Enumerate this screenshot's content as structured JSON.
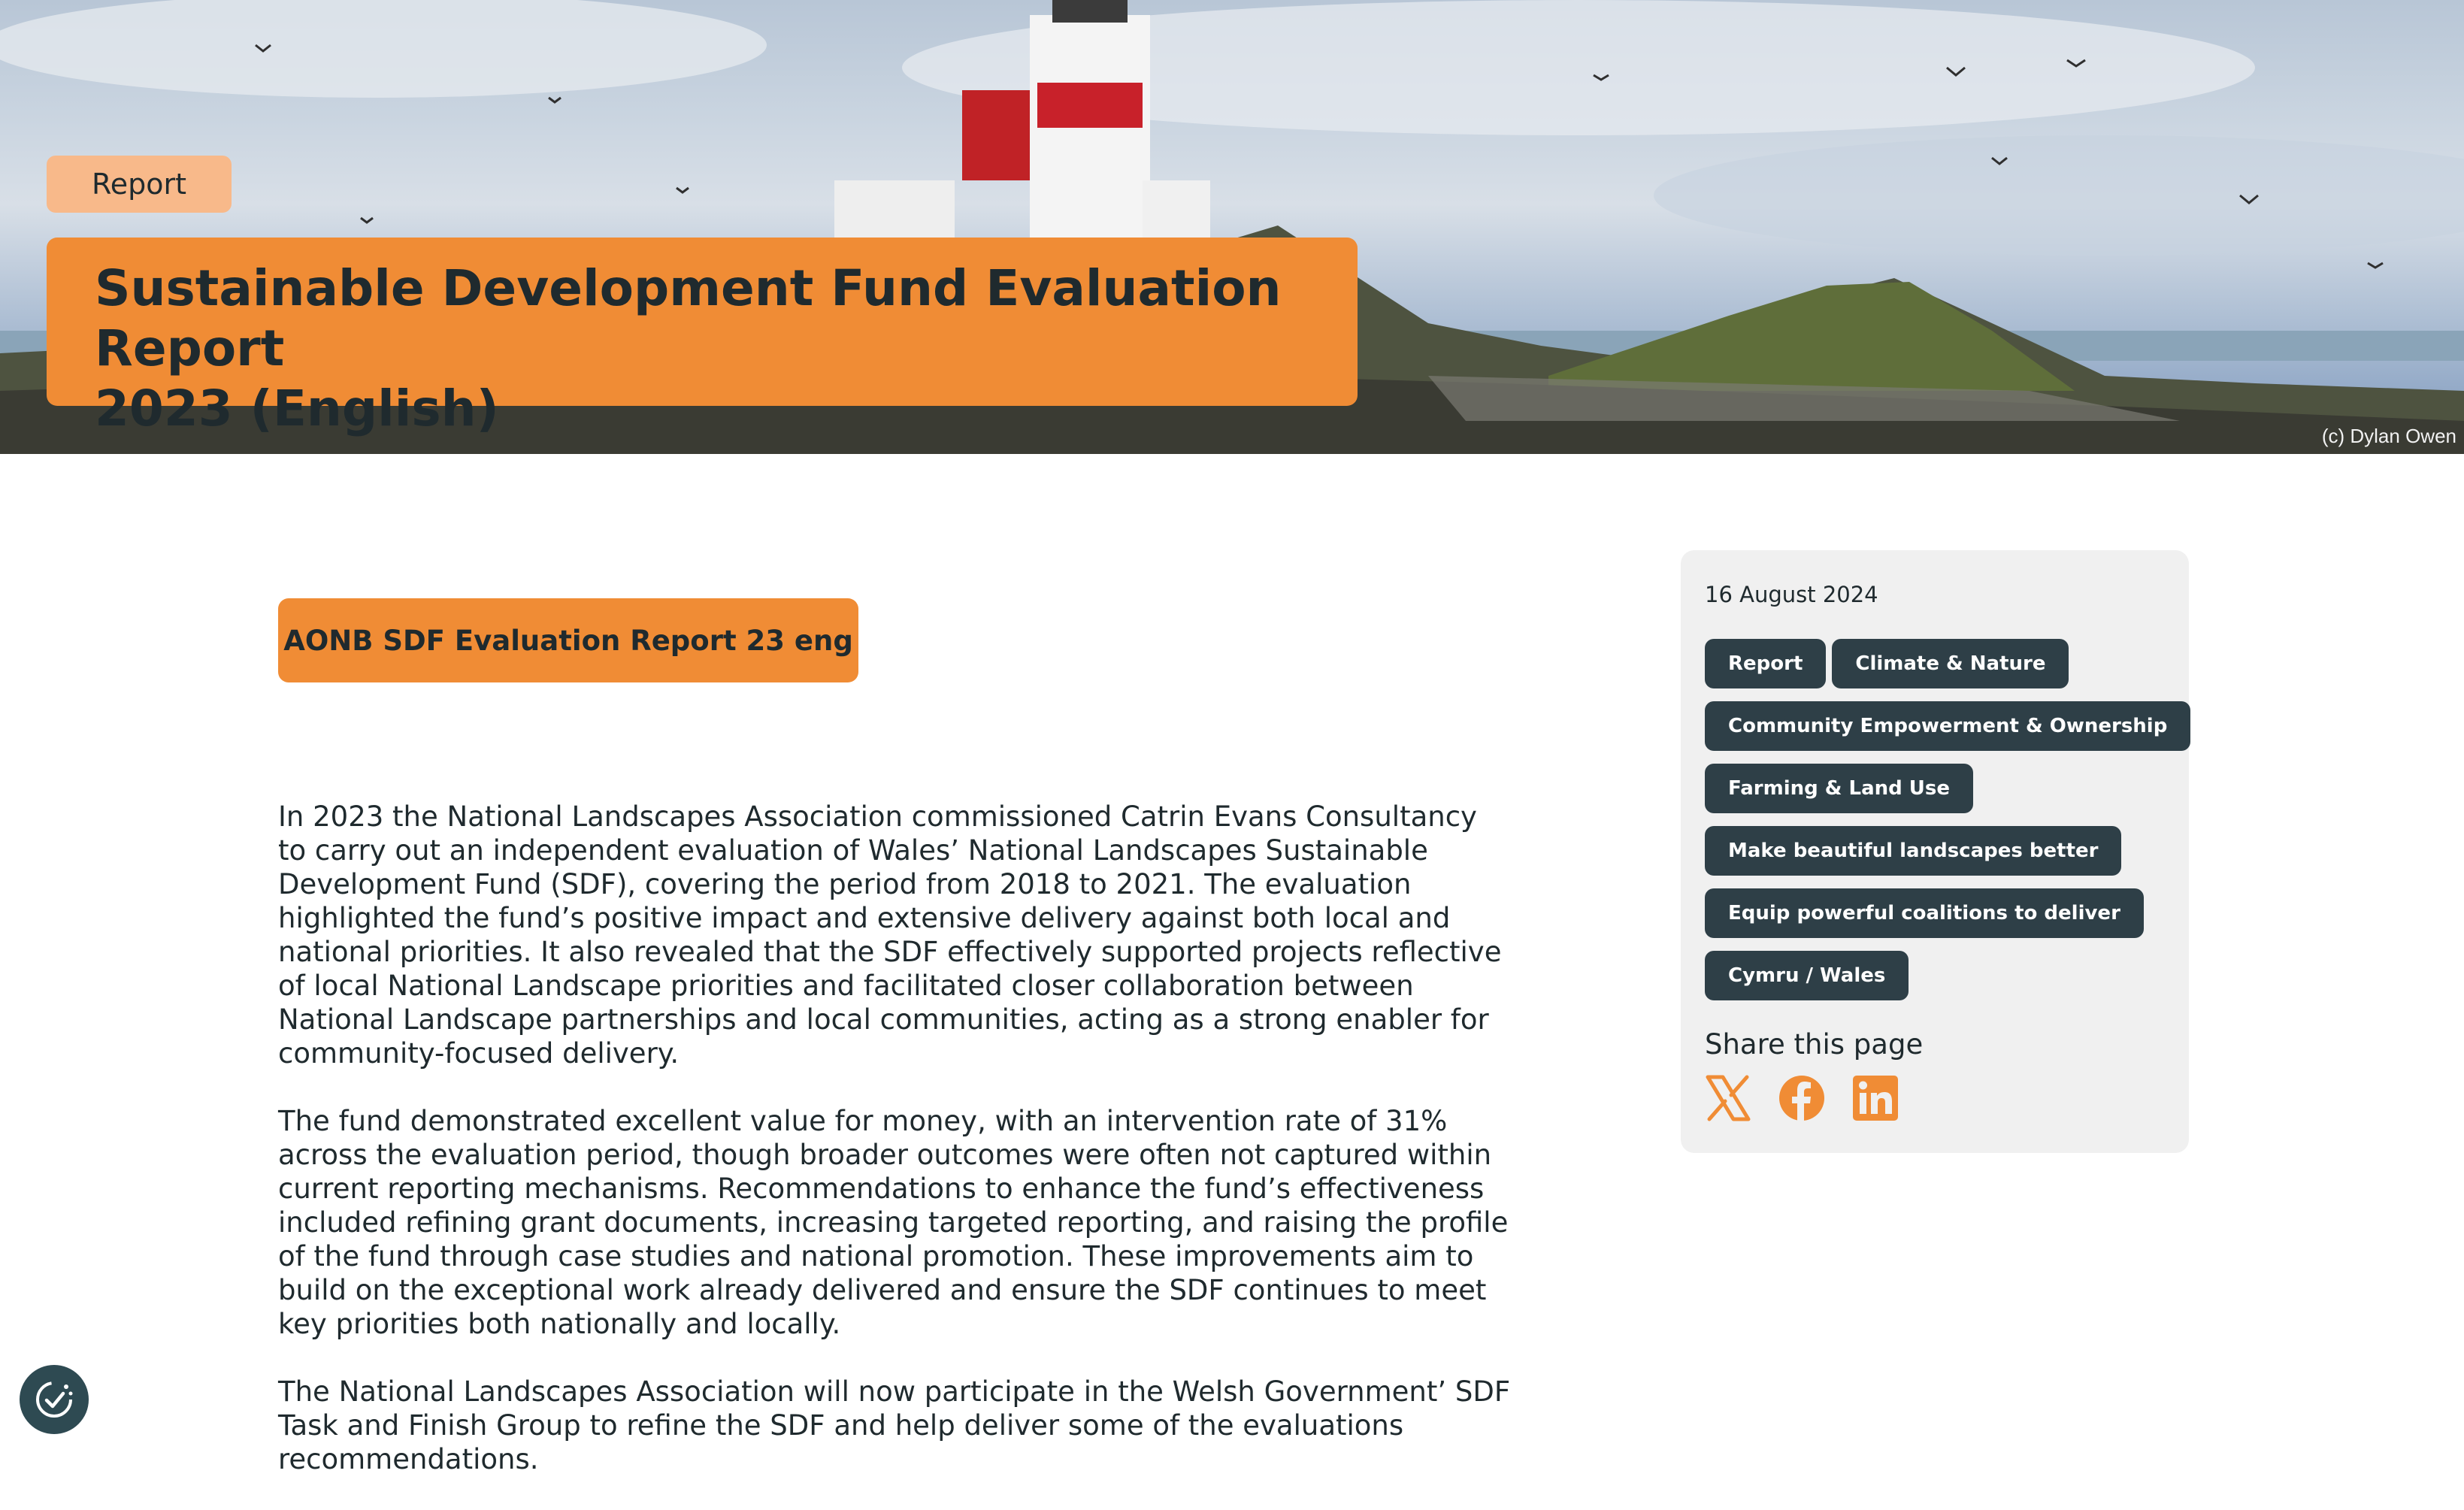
{
  "hero": {
    "tag": "Report",
    "title_line1": "Sustainable Development Fund Evaluation Report",
    "title_line2": "2023 (English)",
    "photo_credit": "(c) Dylan Owen"
  },
  "main": {
    "document_button": "AONB SDF Evaluation Report 23 eng",
    "paragraphs": [
      "In 2023 the National Landscapes Association commissioned Catrin Evans Consultancy to carry out an independent evaluation of Wales’ National Landscapes Sustainable Development Fund (SDF), covering the period from 2018 to 2021. The evaluation highlighted the fund’s positive impact and extensive delivery against both local and national priorities. It also revealed that the SDF effectively supported projects reflective of local National Landscape priorities and facilitated closer collaboration between National Landscape partnerships and local communities, acting as a strong enabler for community-focused delivery.",
      "The fund demonstrated excellent value for money, with an intervention rate of 31% across the evaluation period, though broader outcomes were often not captured within current reporting mechanisms. Recommendations to enhance the fund’s effectiveness included refining grant documents, increasing targeted reporting, and raising the profile of the fund through case studies and national promotion. These improvements aim to build on the exceptional work already delivered and ensure the SDF continues to meet key priorities both nationally and locally.",
      "The National Landscapes Association will now participate in the Welsh Government’ SDF Task and Finish Group to refine the SDF and help deliver some of the evaluations recommendations."
    ]
  },
  "sidebar": {
    "date": "16 August 2024",
    "tags": [
      "Report",
      "Climate & Nature",
      "Community Empowerment & Ownership",
      "Farming & Land Use",
      "Make beautiful landscapes better",
      "Equip powerful coalitions to deliver",
      "Cymru / Wales"
    ],
    "share_label": "Share this page",
    "share_icons": [
      "x-icon",
      "facebook-icon",
      "linkedin-icon"
    ]
  },
  "colors": {
    "accent_orange": "#f08c35",
    "tag_light_orange": "#f8b98a",
    "tag_dark": "#2e3f47",
    "sidebar_bg": "#f0f0f0",
    "text": "#1f2a2e"
  }
}
